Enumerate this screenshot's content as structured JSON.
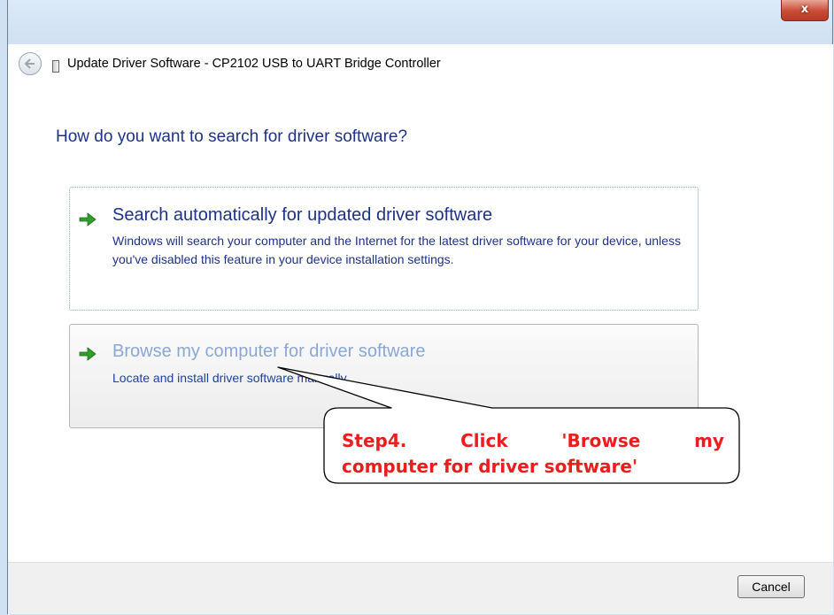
{
  "window": {
    "title": "Update Driver Software - CP2102 USB to UART Bridge Controller",
    "close_label": "x"
  },
  "page": {
    "heading": "How do you want to search for driver software?"
  },
  "options": [
    {
      "title": "Search automatically for updated driver software",
      "description": "Windows will search your computer and the Internet for the latest driver software for your device, unless you've disabled this feature in your device installation settings."
    },
    {
      "title": "Browse my computer for driver software",
      "description": "Locate and install driver software manually."
    }
  ],
  "footer": {
    "cancel_label": "Cancel"
  },
  "callout": {
    "line1_words": [
      "Step4.",
      "Click",
      "'Browse",
      "my"
    ],
    "line2": "computer for driver software'"
  },
  "icons": {
    "back": "back-arrow-icon",
    "device": "usb-device-icon",
    "option_arrow": "green-arrow-icon"
  },
  "colors": {
    "heading": "#1e3287",
    "option_hover_title": "#8ba7d6",
    "arrow_green": "#2f9e2a",
    "callout_text": "#ee1c1c"
  }
}
